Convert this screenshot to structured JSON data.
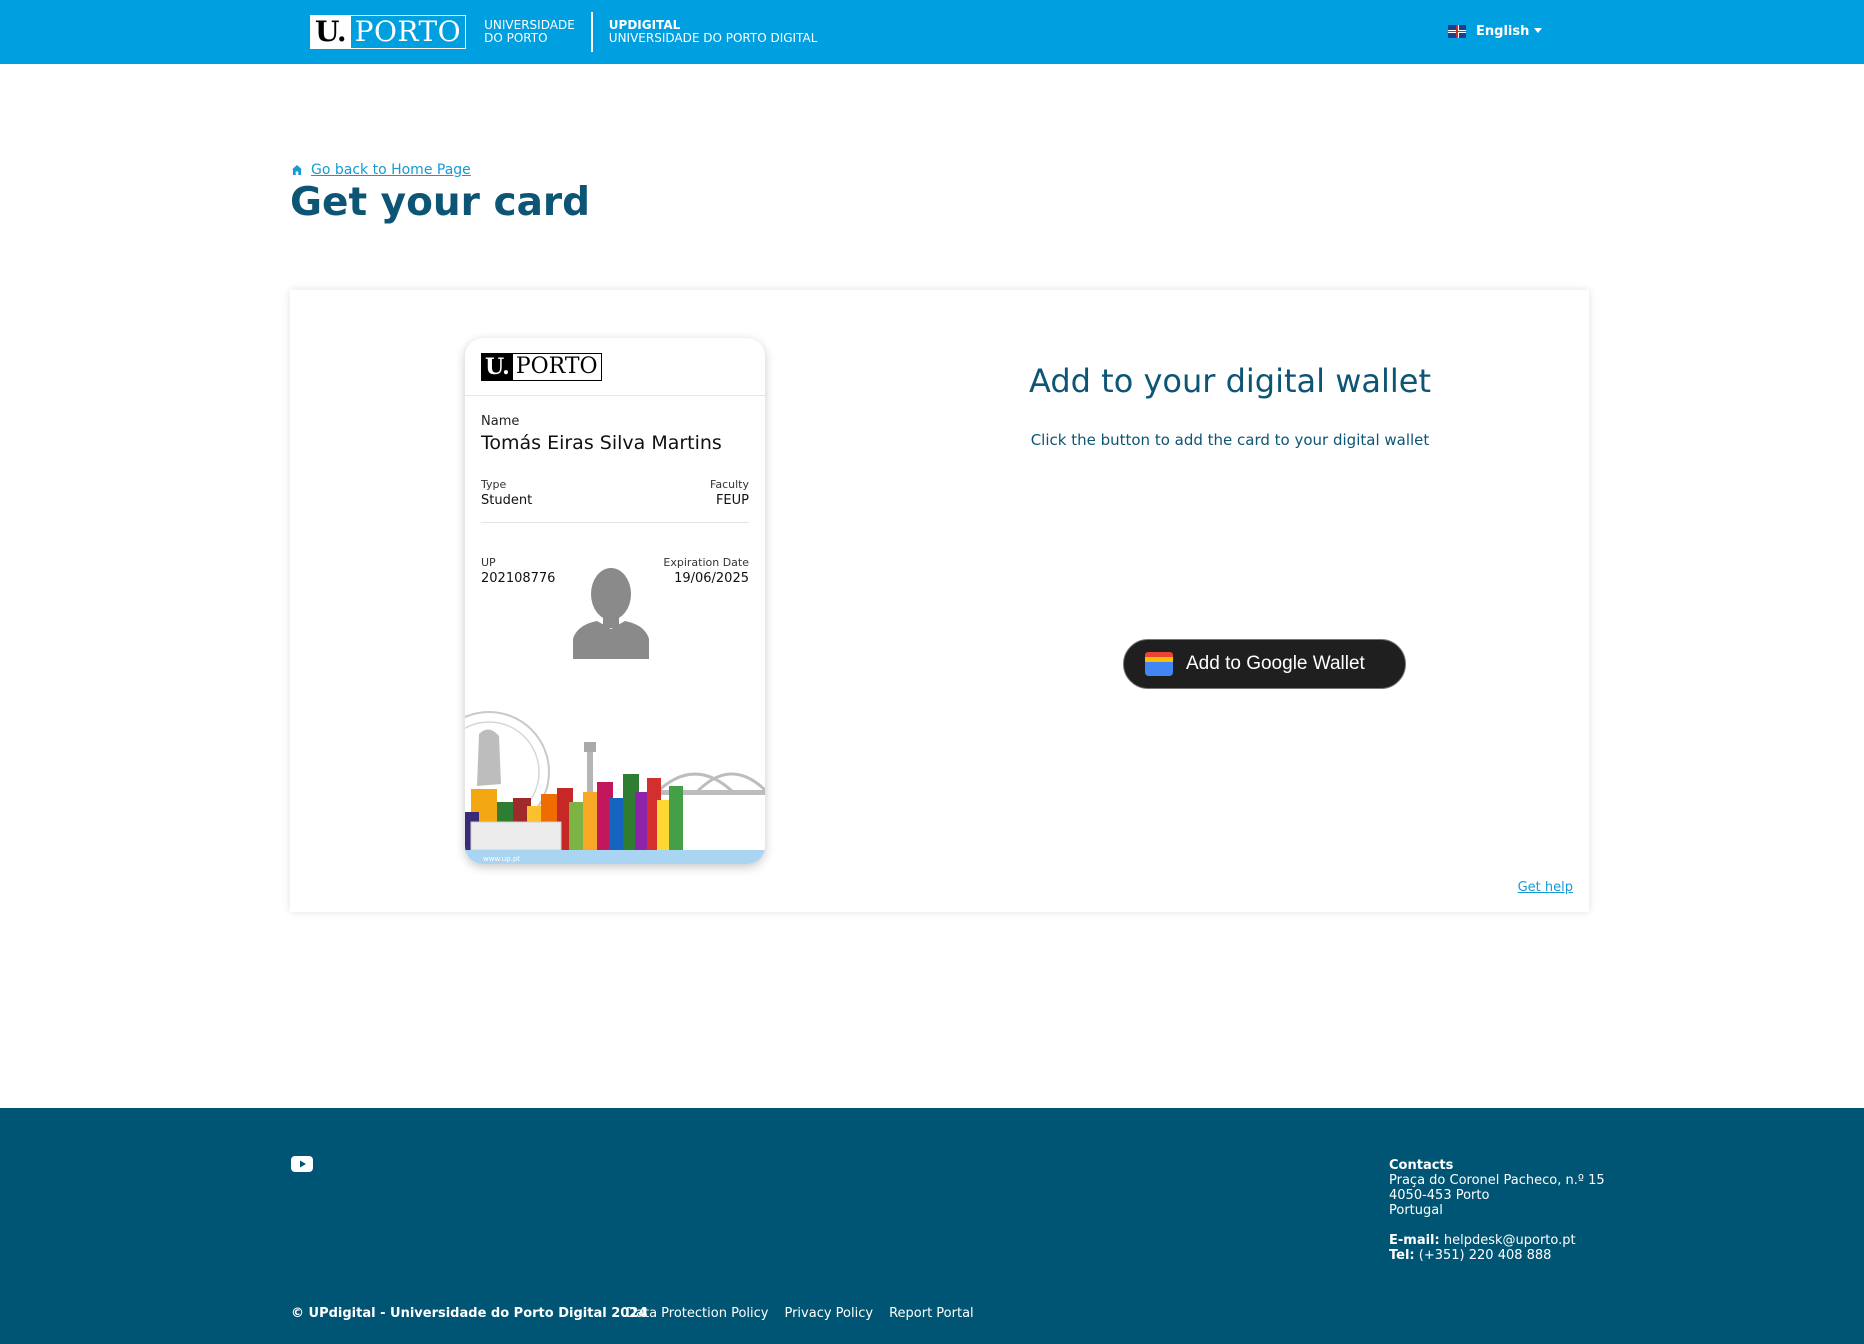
{
  "header": {
    "logo_u": "U.",
    "logo_porto": "PORTO",
    "university_line1": "UNIVERSIDADE",
    "university_line2": "DO PORTO",
    "updigital_title": "UPDIGITAL",
    "updigital_subtitle": "UNIVERSIDADE DO PORTO DIGITAL",
    "language": "English",
    "flag_icon": "uk-flag-icon",
    "accent_color": "#009fe0"
  },
  "page": {
    "back_link": "Go back to Home Page",
    "title": "Get your card"
  },
  "card": {
    "logo_u": "U.",
    "logo_porto": "PORTO",
    "name_label": "Name",
    "name": "Tomás Eiras Silva Martins",
    "type_label": "Type",
    "type": "Student",
    "faculty_label": "Faculty",
    "faculty": "FEUP",
    "up_label": "UP",
    "up_number": "202108776",
    "expiration_label": "Expiration Date",
    "expiration": "19/06/2025",
    "url": "www.up.pt"
  },
  "wallet": {
    "title": "Add to your digital wallet",
    "subtitle": "Click the button to add the card to your digital wallet",
    "button_label": "Add to Google Wallet",
    "help_link": "Get help"
  },
  "footer": {
    "contacts_title": "Contacts",
    "address_line1": "Praça do Coronel Pacheco, n.º 15",
    "address_line2": "4050-453 Porto",
    "address_line3": "Portugal",
    "email_label": "E-mail:",
    "email": "helpdesk@uporto.pt",
    "tel_label": "Tel:",
    "tel": "(+351) 220 408 888",
    "copyright": "© UPdigital - Universidade do Porto Digital 2024",
    "links": [
      "Data Protection Policy",
      "Privacy Policy",
      "Report Portal"
    ],
    "background_color": "#005574"
  }
}
